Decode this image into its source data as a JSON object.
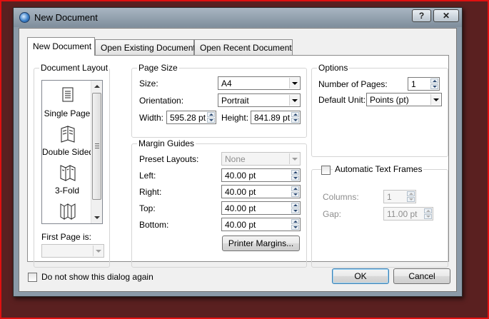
{
  "window": {
    "title": "New Document",
    "help_label": "?",
    "close_label": "✕"
  },
  "tabs": [
    {
      "label": "New Document",
      "active": true
    },
    {
      "label": "Open Existing Document",
      "active": false
    },
    {
      "label": "Open Recent Document",
      "active": false
    }
  ],
  "document_layout": {
    "title": "Document Layout",
    "items": [
      {
        "label": "Single Page",
        "icon": "single-page-icon"
      },
      {
        "label": "Double Sided",
        "icon": "double-sided-icon"
      },
      {
        "label": "3-Fold",
        "icon": "three-fold-icon"
      },
      {
        "label": "",
        "icon": "four-fold-icon"
      }
    ],
    "first_page_label": "First Page is:",
    "first_page_value": ""
  },
  "page_size": {
    "title": "Page Size",
    "size_label": "Size:",
    "size_value": "A4",
    "orientation_label": "Orientation:",
    "orientation_value": "Portrait",
    "width_label": "Width:",
    "width_value": "595.28 pt",
    "height_label": "Height:",
    "height_value": "841.89 pt"
  },
  "margin_guides": {
    "title": "Margin Guides",
    "preset_label": "Preset Layouts:",
    "preset_value": "None",
    "left_label": "Left:",
    "left_value": "40.00 pt",
    "right_label": "Right:",
    "right_value": "40.00 pt",
    "top_label": "Top:",
    "top_value": "40.00 pt",
    "bottom_label": "Bottom:",
    "bottom_value": "40.00 pt",
    "printer_margins_label": "Printer Margins..."
  },
  "options": {
    "title": "Options",
    "pages_label": "Number of Pages:",
    "pages_value": "1",
    "unit_label": "Default Unit:",
    "unit_value": "Points (pt)"
  },
  "text_frames": {
    "checkbox_label": "Automatic Text Frames",
    "checked": false,
    "columns_label": "Columns:",
    "columns_value": "1",
    "gap_label": "Gap:",
    "gap_value": "11.00 pt"
  },
  "footer": {
    "dont_show_label": "Do not show this dialog again",
    "ok_label": "OK",
    "cancel_label": "Cancel"
  }
}
